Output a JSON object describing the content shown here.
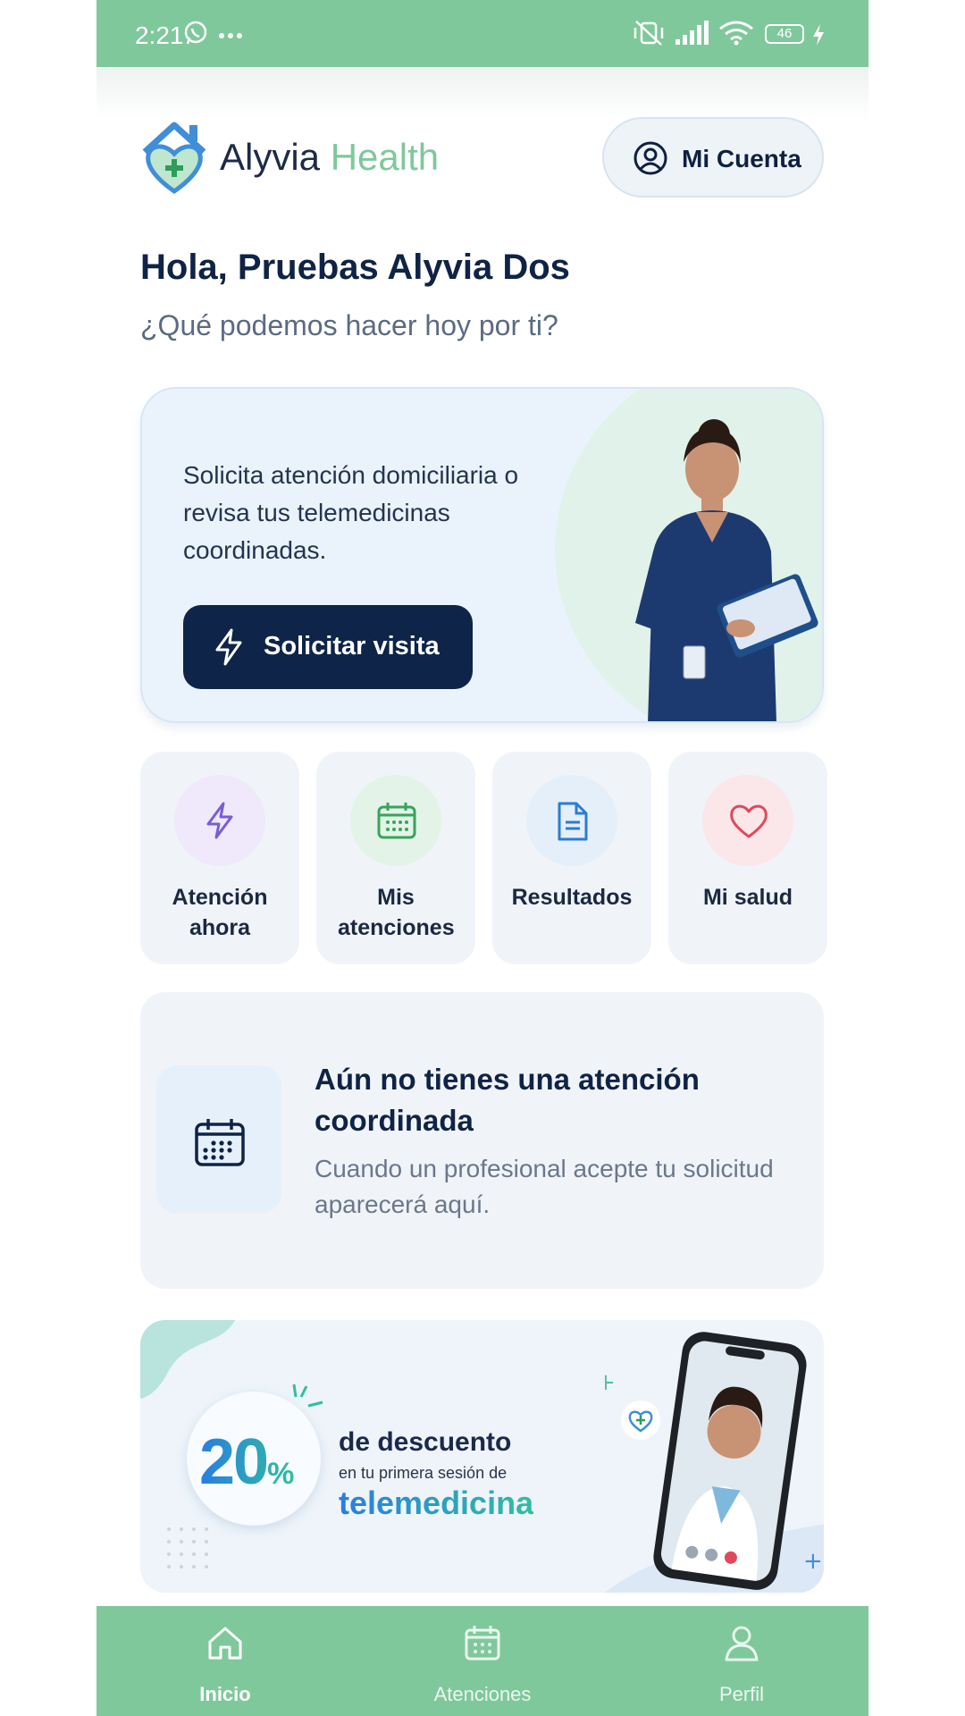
{
  "status_bar": {
    "time": "2:21",
    "battery": "46"
  },
  "header": {
    "brand_first": "Alyvia",
    "brand_second": "Health",
    "account_label": "Mi Cuenta"
  },
  "greeting": {
    "title": "Hola, Pruebas Alyvia Dos",
    "subtitle": "¿Qué podemos hacer hoy por ti?"
  },
  "hero": {
    "text": "Solicita atención domiciliaria o revisa tus telemedicinas coordinadas.",
    "cta_label": "Solicitar visita"
  },
  "quick_actions": [
    {
      "label": "Atención ahora",
      "icon": "lightning-icon",
      "color": "#7a5cd6",
      "bg": "#efe9fb"
    },
    {
      "label": "Mis atenciones",
      "icon": "calendar-icon",
      "color": "#38a45a",
      "bg": "#e3f3e8"
    },
    {
      "label": "Resultados",
      "icon": "document-icon",
      "color": "#2b7cd3",
      "bg": "#e5effa"
    },
    {
      "label": "Mi salud",
      "icon": "heart-icon",
      "color": "#e0485b",
      "bg": "#fbe6ea"
    }
  ],
  "empty_state": {
    "title": "Aún no tienes una atención coordinada",
    "description": "Cuando un profesional acepte tu solicitud aparecerá aquí."
  },
  "promo": {
    "percent": "20",
    "percent_sign": "%",
    "line1": "de descuento",
    "line2": "en tu primera sesión de",
    "line3": "telemedicina"
  },
  "bottom_nav": [
    {
      "label": "Inicio",
      "icon": "home-icon",
      "active": true
    },
    {
      "label": "Atenciones",
      "icon": "calendar-icon",
      "active": false
    },
    {
      "label": "Perfil",
      "icon": "user-icon",
      "active": false
    }
  ],
  "colors": {
    "accent": "#7fc89b",
    "navy": "#0e2448"
  }
}
